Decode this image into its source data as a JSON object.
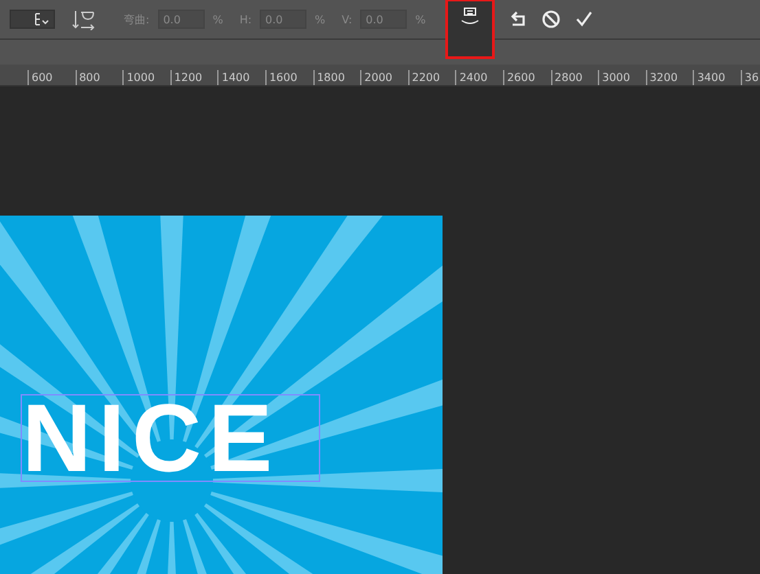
{
  "toolbar": {
    "fields": [
      {
        "label": "弯曲:",
        "value": "0.0",
        "unit": "%"
      },
      {
        "label": "H:",
        "value": "0.0",
        "unit": "%"
      },
      {
        "label": "V:",
        "value": "0.0",
        "unit": "%"
      }
    ],
    "warp_button": {
      "selected": true,
      "highlighted": true
    }
  },
  "ruler": {
    "labels": [
      "600",
      "800",
      "1000",
      "1200",
      "1400",
      "1600",
      "1800",
      "2000",
      "2200",
      "2400",
      "2600",
      "2800",
      "3000",
      "3200",
      "3400",
      "36"
    ]
  },
  "canvas": {
    "text": "NICE"
  }
}
